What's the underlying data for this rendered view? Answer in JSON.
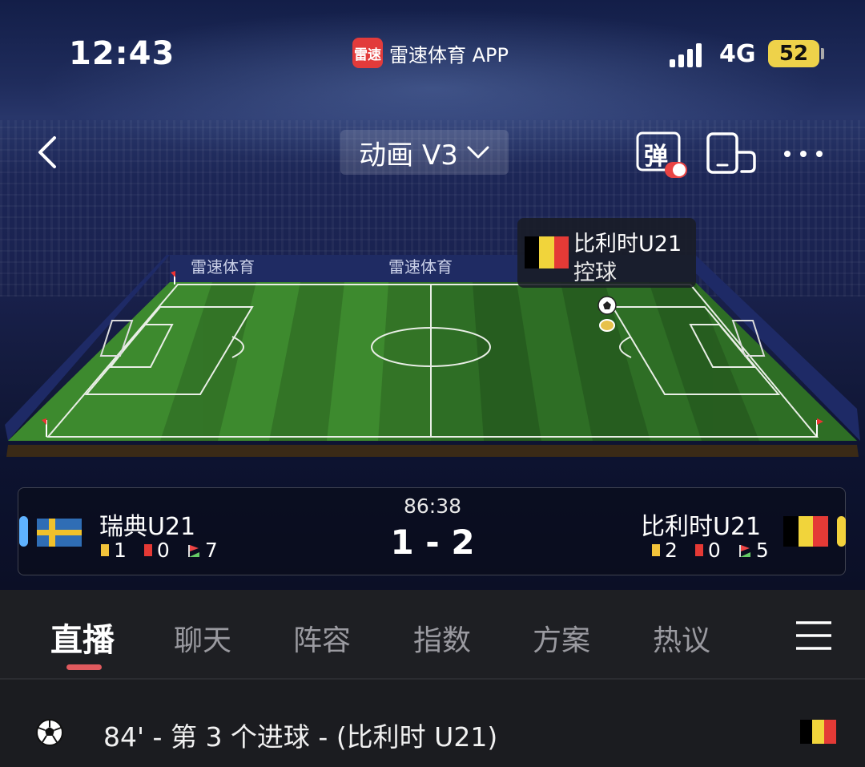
{
  "status_bar": {
    "time": "12:43",
    "app_name": "雷速体育 APP",
    "app_logo_text": "雷速",
    "network": "4G",
    "battery": "52",
    "battery_color": "#eed24a"
  },
  "nav": {
    "mode_label": "动画 V3",
    "danmu_label": "弹",
    "icons": [
      "back-chevron-icon",
      "chevron-down-icon",
      "danmu-toggle-icon",
      "rotate-screen-icon",
      "more-icon"
    ]
  },
  "pitch": {
    "watermark": "雷速体育",
    "possession_team": "比利时U21",
    "possession_label": "控球",
    "grass_colors": [
      "#3d8a2e",
      "#347a27"
    ],
    "attacking_side": "right"
  },
  "match": {
    "time": "86:38",
    "score": "1 - 2",
    "home": {
      "name": "瑞典U21",
      "yellow": "1",
      "red": "0",
      "corners": "7",
      "side_color": "#5fb2ff",
      "flag_colors": [
        "#2f6db5",
        "#f0c12b"
      ]
    },
    "away": {
      "name": "比利时U21",
      "yellow": "2",
      "red": "0",
      "corners": "5",
      "side_color": "#f3d13c",
      "flag_colors": [
        "#000000",
        "#f1d43b",
        "#e43a36"
      ]
    }
  },
  "tabs": [
    {
      "label": "直播",
      "active": true
    },
    {
      "label": "聊天"
    },
    {
      "label": "阵容"
    },
    {
      "label": "指数"
    },
    {
      "label": "方案"
    },
    {
      "label": "热议"
    }
  ],
  "accent_color": "#e05a5e",
  "events": [
    {
      "text": "84' - 第 3 个进球 - (比利时 U21)",
      "icon": "soccer-ball-icon"
    }
  ]
}
